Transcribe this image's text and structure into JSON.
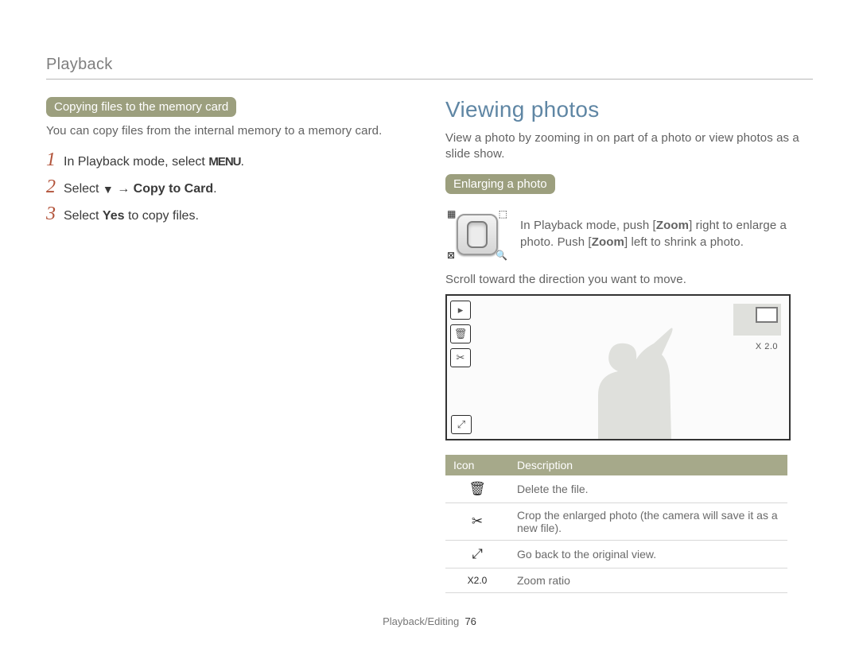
{
  "header": {
    "section": "Playback"
  },
  "left": {
    "pill": "Copying files to the memory card",
    "intro": "You can copy files from the internal memory to a memory card.",
    "steps": [
      {
        "n": "1",
        "pre": "In Playback mode, select ",
        "glyph": "MENU",
        "post": "."
      },
      {
        "n": "2",
        "pre": "Select ",
        "glyphArrow": true,
        "mid": " → ",
        "bold": "Copy to Card",
        "post": "."
      },
      {
        "n": "3",
        "pre": "Select ",
        "bold": "Yes",
        "post": " to copy files."
      }
    ]
  },
  "right": {
    "title": "Viewing photos",
    "intro": "View a photo by zooming in on part of a photo or view photos as a slide show.",
    "pill": "Enlarging a photo",
    "zoomText": {
      "pre": "In Playback mode, push [",
      "b1": "Zoom",
      "mid1": "] right to enlarge a photo. Push [",
      "b2": "Zoom",
      "post": "] left to shrink a photo."
    },
    "scrollNote": "Scroll toward the direction you want to move.",
    "zoomLabel": "X 2.0",
    "zoomCorners": {
      "tl": "▦",
      "tr": "⬚",
      "bl": "⊠",
      "br": "🔍"
    },
    "viewerIcons": {
      "play": "▸",
      "trash": "🗑",
      "crop": "✂",
      "zoomOut": "⤢"
    },
    "table": {
      "head": {
        "icon": "Icon",
        "desc": "Description"
      },
      "rows": [
        {
          "icon": "🗑",
          "desc": "Delete the file."
        },
        {
          "icon": "✂",
          "desc": "Crop the enlarged photo (the camera will save it as a new file)."
        },
        {
          "icon": "⤢",
          "desc": "Go back to the original view."
        },
        {
          "icon": "X2.0",
          "desc": "Zoom ratio"
        }
      ]
    }
  },
  "footer": {
    "label": "Playback/Editing",
    "page": "76"
  }
}
